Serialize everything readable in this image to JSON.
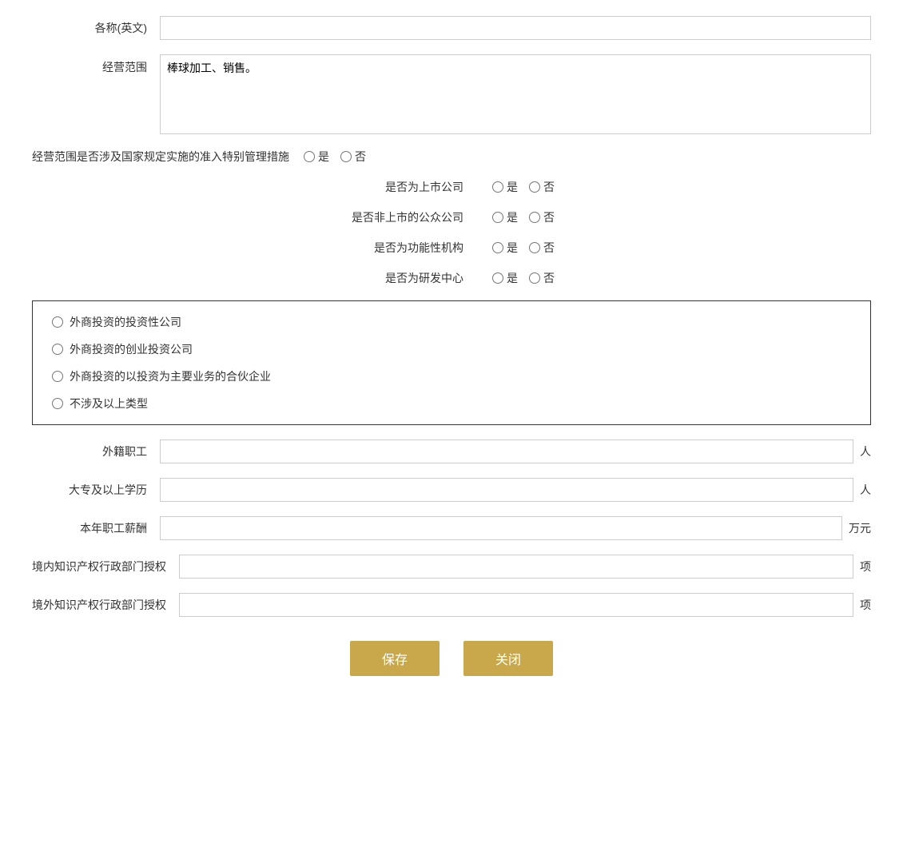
{
  "form": {
    "name_en_label": "各称(英文)",
    "name_en_placeholder": "",
    "business_scope_label": "经营范围",
    "business_scope_value": "棒球加工、销售。",
    "special_management_label": "经营范围是否涉及国家规定实施的准入特别管理措施",
    "special_management_yes": "是",
    "special_management_no": "否",
    "listed_company_label": "是否为上市公司",
    "listed_yes": "是",
    "listed_no": "否",
    "non_listed_public_label": "是否非上市的公众公司",
    "non_listed_yes": "是",
    "non_listed_no": "否",
    "functional_institution_label": "是否为功能性机构",
    "functional_yes": "是",
    "functional_no": "否",
    "rd_center_label": "是否为研发中心",
    "rd_yes": "是",
    "rd_no": "否",
    "investment_options": [
      "外商投资的投资性公司",
      "外商投资的创业投资公司",
      "外商投资的以投资为主要业务的合伙企业",
      "不涉及以上类型"
    ],
    "foreign_staff_label": "外籍职工",
    "foreign_staff_unit": "人",
    "college_education_label": "大专及以上学历",
    "college_education_unit": "人",
    "annual_salary_label": "本年职工薪酬",
    "annual_salary_unit": "万元",
    "domestic_ip_label": "境内知识产权行政部门授权",
    "domestic_ip_unit": "项",
    "foreign_ip_label": "境外知识产权行政部门授权",
    "foreign_ip_unit": "项",
    "save_button": "保存",
    "close_button": "关闭"
  }
}
